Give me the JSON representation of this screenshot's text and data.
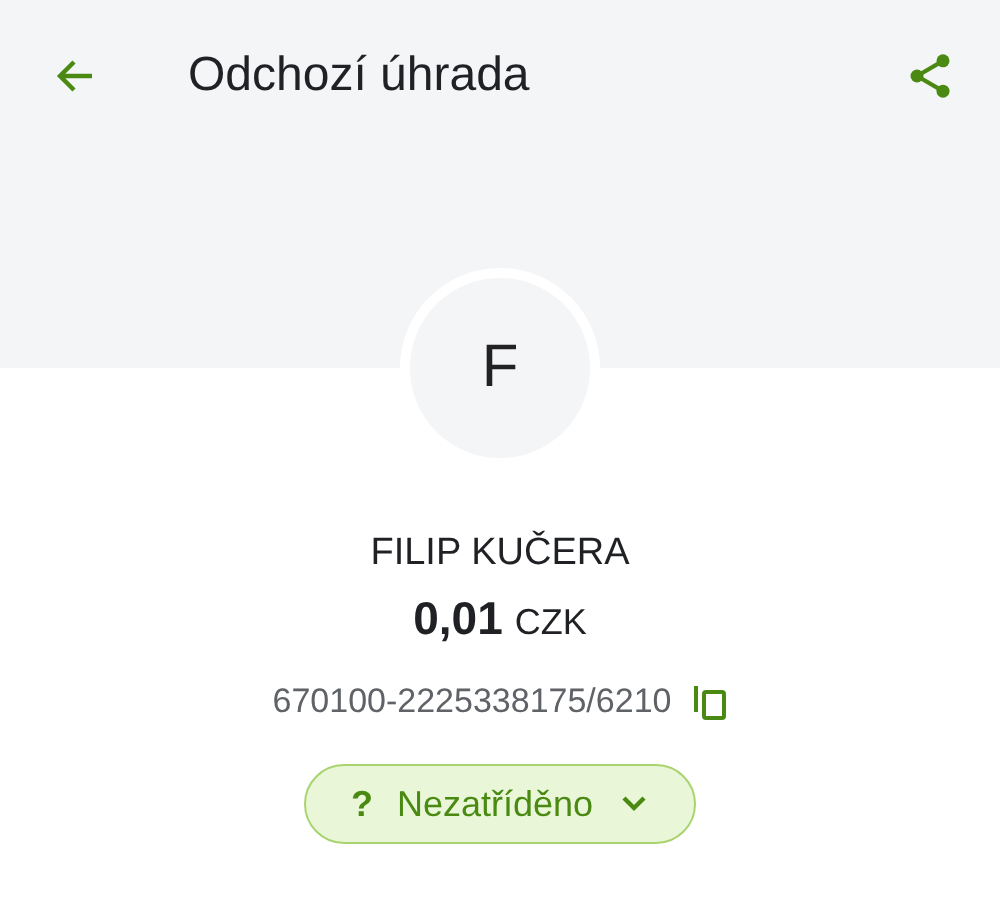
{
  "header": {
    "title": "Odchozí úhrada"
  },
  "avatar": {
    "initial": "F"
  },
  "payee": {
    "name": "FILIP KUČERA",
    "amount": "0,01",
    "currency": "CZK",
    "account": "670100-2225338175/6210"
  },
  "category": {
    "mark": "?",
    "label": "Nezatříděno",
    "expanded": false
  }
}
